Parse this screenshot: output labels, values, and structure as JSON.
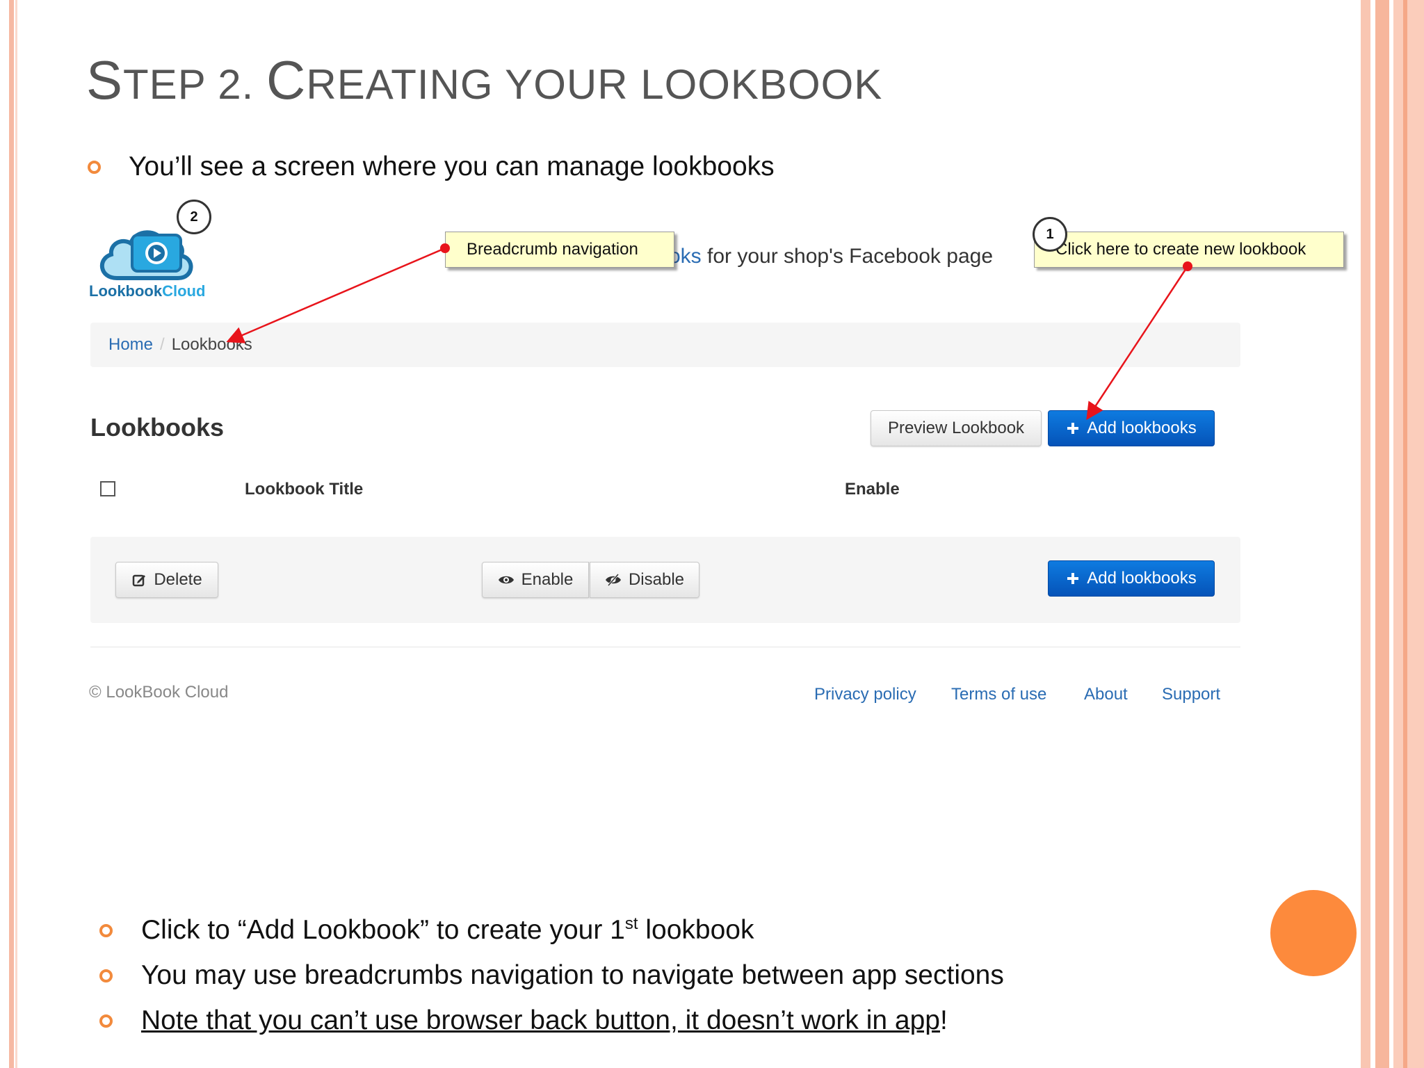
{
  "slide": {
    "title_lead_S": "S",
    "title_part1": "TEP 2. ",
    "title_lead_C": "C",
    "title_part2": "REATING YOUR LOOKBOOK",
    "intro_bullet": "You’ll see a screen where you can manage lookbooks",
    "bullets": [
      {
        "before": "Click to “Add Lookbook” to create your 1",
        "sup": "st",
        "after": " lookbook"
      },
      {
        "text": "You may use breadcrumbs navigation to navigate between app sections"
      },
      {
        "underlined": "Note that you can’t use browser back button, it doesn’t work in app",
        "after": "!"
      }
    ]
  },
  "app": {
    "logo_text_a": "Lookbook",
    "logo_text_b": "Cloud",
    "tagline_blue": "oks",
    "tagline_rest": " for your shop's Facebook page",
    "breadcrumb": {
      "home": "Home",
      "separator": "/",
      "current": "Lookbooks"
    },
    "heading": "Lookbooks",
    "preview_button": "Preview Lookbook",
    "add_button": "Add lookbooks",
    "table": {
      "col_title": "Lookbook Title",
      "col_enable": "Enable"
    },
    "actions": {
      "delete": "Delete",
      "enable": "Enable",
      "disable": "Disable",
      "add": "Add lookbooks"
    },
    "footer": {
      "copyright": "© LookBook Cloud",
      "links": [
        "Privacy policy",
        "Terms of use",
        "About",
        "Support"
      ]
    }
  },
  "annotations": {
    "callout_breadcrumb": "Breadcrumb navigation",
    "callout_add": "Click here to create new lookbook",
    "num_1": "1",
    "num_2": "2"
  },
  "colors": {
    "bullet_ring": "#f28a3c",
    "link_blue": "#2a6cb3",
    "primary_button": "#0a66cc",
    "callout_bg": "#ffffcc",
    "arrow_red": "#e8141b",
    "orange_circle": "#fd8a3c"
  }
}
